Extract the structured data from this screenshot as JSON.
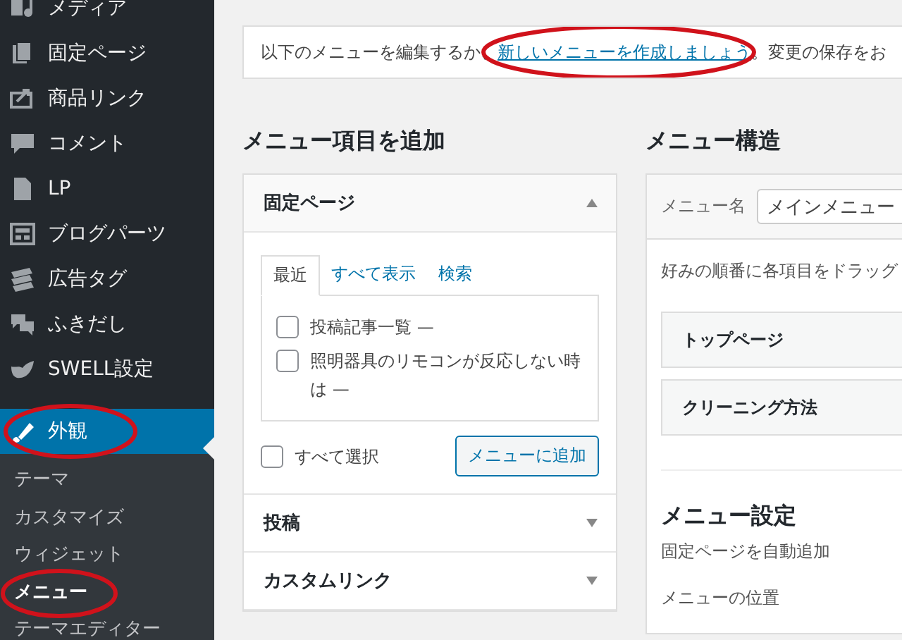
{
  "sidebar": {
    "items": [
      {
        "label": "メディア",
        "selected": false,
        "circled": false
      },
      {
        "label": "固定ページ",
        "selected": false,
        "circled": false
      },
      {
        "label": "商品リンク",
        "selected": false,
        "circled": false
      },
      {
        "label": "コメント",
        "selected": false,
        "circled": false
      },
      {
        "label": "LP",
        "selected": false,
        "circled": false
      },
      {
        "label": "ブログパーツ",
        "selected": false,
        "circled": false
      },
      {
        "label": "広告タグ",
        "selected": false,
        "circled": false
      },
      {
        "label": "ふきだし",
        "selected": false,
        "circled": false
      },
      {
        "label": "SWELL設定",
        "selected": false,
        "circled": false
      },
      {
        "label": "外観",
        "selected": true,
        "circled": true
      }
    ],
    "submenu": [
      {
        "label": "テーマ",
        "selected": false,
        "circled": false
      },
      {
        "label": "カスタマイズ",
        "selected": false,
        "circled": false
      },
      {
        "label": "ウィジェット",
        "selected": false,
        "circled": false
      },
      {
        "label": "メニュー",
        "selected": true,
        "circled": true
      },
      {
        "label": "テーマエディター",
        "selected": false,
        "circled": false
      }
    ]
  },
  "notice": {
    "before": "以下のメニューを編集するか、",
    "link": "新しいメニューを作成しましょう",
    "link_circled": true,
    "after": "。変更の保存をお"
  },
  "add_items": {
    "title": "メニュー項目を追加",
    "sections": [
      {
        "title": "固定ページ",
        "expanded": true,
        "tabs": [
          {
            "label": "最近",
            "selected": true
          },
          {
            "label": "すべて表示",
            "selected": false
          },
          {
            "label": "検索",
            "selected": false
          }
        ],
        "items": [
          {
            "label": "投稿記事一覧 —",
            "checked": false
          },
          {
            "label": "照明器具のリモコンが反応しない時は —",
            "checked": false
          }
        ],
        "select_all": {
          "label": "すべて選択",
          "checked": false
        },
        "button": "メニューに追加"
      },
      {
        "title": "投稿",
        "expanded": false
      },
      {
        "title": "カスタムリンク",
        "expanded": false
      }
    ]
  },
  "structure": {
    "title": "メニュー構造",
    "name_label": "メニュー名",
    "name_value": "メインメニュー",
    "hint": "好みの順番に各項目をドラッグ",
    "items": [
      "トップページ",
      "クリーニング方法"
    ],
    "settings_title": "メニュー設定",
    "settings": [
      "固定ページを自動追加",
      "メニューの位置"
    ]
  }
}
